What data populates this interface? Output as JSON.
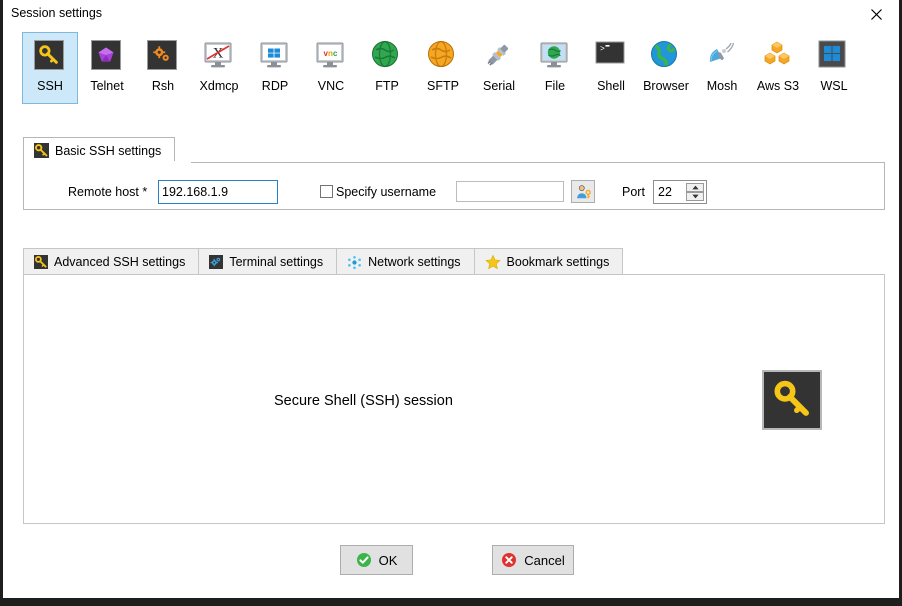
{
  "window": {
    "title": "Session settings",
    "close_icon": "close-icon"
  },
  "protocols": [
    {
      "id": "ssh",
      "label": "SSH",
      "icon": "key-icon",
      "selected": true
    },
    {
      "id": "telnet",
      "label": "Telnet",
      "icon": "crystal-icon",
      "selected": false
    },
    {
      "id": "rsh",
      "label": "Rsh",
      "icon": "gears-icon",
      "selected": false
    },
    {
      "id": "xdmcp",
      "label": "Xdmcp",
      "icon": "x-monitor-icon",
      "selected": false
    },
    {
      "id": "rdp",
      "label": "RDP",
      "icon": "windows-monitor-icon",
      "selected": false
    },
    {
      "id": "vnc",
      "label": "VNC",
      "icon": "vnc-monitor-icon",
      "selected": false
    },
    {
      "id": "ftp",
      "label": "FTP",
      "icon": "green-globe-icon",
      "selected": false
    },
    {
      "id": "sftp",
      "label": "SFTP",
      "icon": "orange-globe-icon",
      "selected": false
    },
    {
      "id": "serial",
      "label": "Serial",
      "icon": "plug-icon",
      "selected": false
    },
    {
      "id": "file",
      "label": "File",
      "icon": "file-monitor-icon",
      "selected": false
    },
    {
      "id": "shell",
      "label": "Shell",
      "icon": "terminal-icon",
      "selected": false
    },
    {
      "id": "browser",
      "label": "Browser",
      "icon": "blue-globe-icon",
      "selected": false
    },
    {
      "id": "mosh",
      "label": "Mosh",
      "icon": "satellite-icon",
      "selected": false
    },
    {
      "id": "awss3",
      "label": "Aws S3",
      "icon": "aws-cubes-icon",
      "selected": false
    },
    {
      "id": "wsl",
      "label": "WSL",
      "icon": "windows-icon",
      "selected": false
    }
  ],
  "basic": {
    "tab_label": "Basic SSH settings",
    "tab_icon": "key-icon",
    "remote_host_label": "Remote host *",
    "remote_host_value": "192.168.1.9",
    "remote_host_placeholder": "",
    "specify_username_label": "Specify username",
    "specify_username_checked": false,
    "username_value": "",
    "username_placeholder": "",
    "user_button_icon": "user-key-icon",
    "port_label": "Port",
    "port_value": "22",
    "spin_up_icon": "chevron-up-icon",
    "spin_down_icon": "chevron-down-icon"
  },
  "bottom_tabs": [
    {
      "id": "advanced",
      "label": "Advanced SSH settings",
      "icon": "key-icon"
    },
    {
      "id": "terminal",
      "label": "Terminal settings",
      "icon": "terminal-gear-icon"
    },
    {
      "id": "network",
      "label": "Network settings",
      "icon": "network-nodes-icon"
    },
    {
      "id": "bookmark",
      "label": "Bookmark settings",
      "icon": "star-icon"
    }
  ],
  "content": {
    "session_description": "Secure Shell (SSH) session",
    "session_icon": "key-icon"
  },
  "buttons": {
    "ok_label": "OK",
    "ok_icon": "check-circle-icon",
    "cancel_label": "Cancel",
    "cancel_icon": "x-circle-icon"
  },
  "colors": {
    "selected_tab_bg": "#cce8f9",
    "selected_tab_border": "#7fb9dd",
    "focus_border": "#2a7fc9",
    "key_yellow": "#f5c518",
    "ok_green": "#3cb44b",
    "cancel_red": "#e03030",
    "dialog_border": "#1e1e1e"
  }
}
